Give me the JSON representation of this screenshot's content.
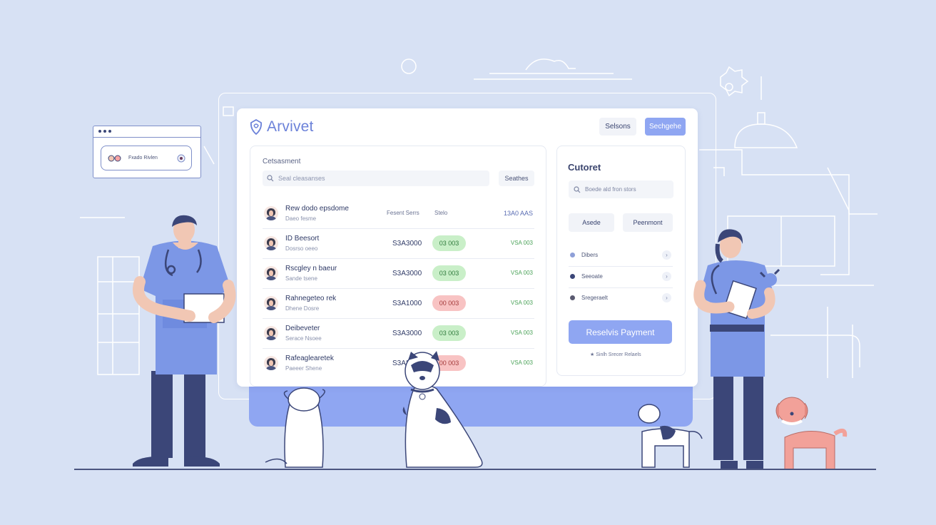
{
  "brand": {
    "name": "Arvivet"
  },
  "header": {
    "sessions_label": "Selsons",
    "schedule_label": "Sechgehe"
  },
  "mini_window": {
    "text": "Fxado Rivlen"
  },
  "list": {
    "label": "Cetsasment",
    "search_placeholder": "Seal cleasanses",
    "search_button": "Seathes",
    "header": {
      "name": "Rew dodo epsdome",
      "sub": "Daeo fesme",
      "col1": "Fesent  Serrs",
      "col2": "Stelo",
      "right": "13A0 AAS"
    },
    "rows": [
      {
        "name": "ID Beesort",
        "sub": "Dosrso oeeo",
        "amount": "S3A3000",
        "status": "03 003",
        "status_color": "green",
        "right": "VSA 003"
      },
      {
        "name": "Rscgley n baeur",
        "sub": "Sande tsene",
        "amount": "S3A3000",
        "status": "03 003",
        "status_color": "green",
        "right": "VSA 003"
      },
      {
        "name": "Rahnegeteo rek",
        "sub": "Dhene Dosre",
        "amount": "S3A1000",
        "status": "00 003",
        "status_color": "red",
        "right": "VSA 003"
      },
      {
        "name": "Deibeveter",
        "sub": "Serace Nsoee",
        "amount": "S3A3000",
        "status": "03 003",
        "status_color": "green",
        "right": "VSA 003"
      },
      {
        "name": "Rafeaglearetek",
        "sub": "Paeeer Shene",
        "amount": "S3A3000",
        "status": "00 003",
        "status_color": "red",
        "right": "VSA 003"
      }
    ]
  },
  "side": {
    "title": "Cutoret",
    "search_placeholder": "Boede ald fron stors",
    "btn_one": "Asede",
    "btn_two": "Peenmont",
    "items": [
      "Dibers",
      "Seeoate",
      "Sregeraelt"
    ],
    "chevron": "›",
    "pay_button": "Reselvis Payment",
    "note": "★  Sinlh Srecer Relaels"
  },
  "colors": {
    "accent": "#8fa6f2",
    "background": "#d7e1f4",
    "green_pill": "#c9efc8",
    "red_pill": "#f8c3c3",
    "dark_navy": "#3b4678"
  }
}
